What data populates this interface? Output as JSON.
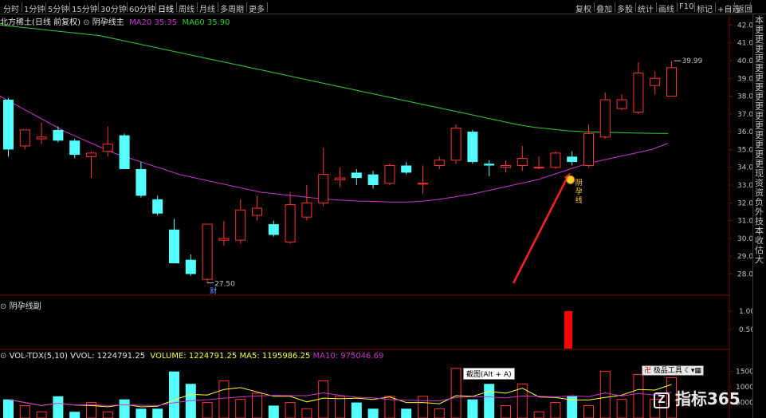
{
  "toolbar": {
    "periods": [
      "分时",
      "1分钟",
      "5分钟",
      "15分钟",
      "30分钟",
      "60分钟",
      "日线",
      "周线",
      "月线",
      "多周期",
      "更多"
    ],
    "active_period": "日线",
    "right_buttons": [
      "复权",
      "叠加",
      "多股",
      "统计",
      "画线",
      "F10",
      "标记",
      "+自选",
      "返回"
    ]
  },
  "main_chart": {
    "title": "北方稀土(日线 前复权)",
    "indicator_name": "阴孕线主",
    "ma20_label": "MA20",
    "ma20_value": "35.35",
    "ma60_label": "MA60",
    "ma60_value": "35.90",
    "price_ticks": [
      "42.00",
      "41.00",
      "40.00",
      "39.00",
      "38.00",
      "37.00",
      "36.00",
      "35.00",
      "34.00",
      "33.00",
      "32.00",
      "31.00",
      "30.00",
      "29.00",
      "28.00"
    ],
    "high_label": "39.99",
    "low_label": "27.50",
    "finance_marker": "财",
    "signal_text": "阴孕线",
    "colors": {
      "up": "#ff3232",
      "down": "#54ffff",
      "ma20": "#cc33cc",
      "ma60": "#33cc33",
      "arrow": "#ff2020"
    }
  },
  "sub_chart": {
    "title": "阴孕线副",
    "ticks": [
      "1.00",
      "0.50"
    ],
    "signal_value": 1.0
  },
  "volume_chart": {
    "title": "VOL-TDX(5,10)",
    "vvol": "VVOL: 1224791.25",
    "volume": "VOLUME: 1224791.25",
    "ma5": "MA5: 1195986.25",
    "ma10": "MA10: 975046.69",
    "ticks": [
      "15000",
      "10000",
      "5000"
    ],
    "tooltip": "截图(Alt + A)",
    "toolbox_label": "极品工具"
  },
  "side_panel": {
    "chars": [
      "本",
      "更",
      "更",
      "更",
      "更",
      "更",
      "更",
      "更",
      "更",
      "更",
      "更",
      "更",
      "更",
      "更",
      "更",
      "更",
      "现",
      "资",
      "资",
      "负",
      "外",
      "技",
      "本",
      "收",
      "估",
      "大"
    ]
  },
  "watermark": "指标365",
  "chart_data": {
    "type": "candlestick",
    "ylim": [
      27,
      42.5
    ],
    "candles": [
      {
        "o": 37.8,
        "h": 37.9,
        "l": 34.6,
        "c": 35.0
      },
      {
        "o": 35.2,
        "h": 36.0,
        "l": 35.0,
        "c": 36.1
      },
      {
        "o": 35.6,
        "h": 36.5,
        "l": 35.3,
        "c": 35.7
      },
      {
        "o": 36.1,
        "h": 36.3,
        "l": 35.4,
        "c": 35.5
      },
      {
        "o": 35.5,
        "h": 35.6,
        "l": 34.5,
        "c": 34.7
      },
      {
        "o": 34.6,
        "h": 34.9,
        "l": 33.4,
        "c": 34.8
      },
      {
        "o": 34.9,
        "h": 36.3,
        "l": 34.6,
        "c": 35.3
      },
      {
        "o": 35.8,
        "h": 35.9,
        "l": 33.9,
        "c": 33.9
      },
      {
        "o": 33.9,
        "h": 34.3,
        "l": 32.3,
        "c": 32.4
      },
      {
        "o": 32.2,
        "h": 32.4,
        "l": 31.3,
        "c": 31.4
      },
      {
        "o": 30.5,
        "h": 31.1,
        "l": 28.6,
        "c": 28.6
      },
      {
        "o": 28.8,
        "h": 29.1,
        "l": 27.9,
        "c": 28.0
      },
      {
        "o": 27.7,
        "h": 30.8,
        "l": 27.5,
        "c": 30.8
      },
      {
        "o": 29.9,
        "h": 31.0,
        "l": 29.6,
        "c": 30.0
      },
      {
        "o": 29.9,
        "h": 32.2,
        "l": 29.7,
        "c": 31.6
      },
      {
        "o": 31.3,
        "h": 32.4,
        "l": 31.0,
        "c": 31.7
      },
      {
        "o": 30.8,
        "h": 31.0,
        "l": 30.1,
        "c": 30.2
      },
      {
        "o": 29.8,
        "h": 32.6,
        "l": 29.7,
        "c": 31.9
      },
      {
        "o": 31.2,
        "h": 33.0,
        "l": 31.0,
        "c": 32.0
      },
      {
        "o": 32.0,
        "h": 35.1,
        "l": 31.8,
        "c": 33.6
      },
      {
        "o": 33.3,
        "h": 34.0,
        "l": 32.9,
        "c": 33.4
      },
      {
        "o": 33.7,
        "h": 33.9,
        "l": 33.0,
        "c": 33.4
      },
      {
        "o": 33.6,
        "h": 33.8,
        "l": 32.8,
        "c": 33.0
      },
      {
        "o": 33.1,
        "h": 34.2,
        "l": 33.0,
        "c": 34.1
      },
      {
        "o": 34.1,
        "h": 34.3,
        "l": 33.6,
        "c": 33.7
      },
      {
        "o": 33.1,
        "h": 34.1,
        "l": 32.5,
        "c": 33.1
      },
      {
        "o": 34.1,
        "h": 34.6,
        "l": 33.9,
        "c": 34.4
      },
      {
        "o": 34.4,
        "h": 36.4,
        "l": 34.2,
        "c": 36.2
      },
      {
        "o": 36.0,
        "h": 36.1,
        "l": 34.2,
        "c": 34.3
      },
      {
        "o": 34.2,
        "h": 34.4,
        "l": 33.5,
        "c": 34.1
      },
      {
        "o": 34.0,
        "h": 34.4,
        "l": 33.7,
        "c": 34.1
      },
      {
        "o": 34.1,
        "h": 35.2,
        "l": 33.8,
        "c": 34.5
      },
      {
        "o": 34.0,
        "h": 34.6,
        "l": 33.9,
        "c": 34.0
      },
      {
        "o": 34.0,
        "h": 34.9,
        "l": 33.9,
        "c": 34.8
      },
      {
        "o": 34.6,
        "h": 34.9,
        "l": 34.1,
        "c": 34.3
      },
      {
        "o": 34.1,
        "h": 36.4,
        "l": 34.0,
        "c": 35.9
      },
      {
        "o": 35.7,
        "h": 38.2,
        "l": 35.6,
        "c": 37.8
      },
      {
        "o": 37.3,
        "h": 38.1,
        "l": 37.2,
        "c": 37.8
      },
      {
        "o": 37.1,
        "h": 39.9,
        "l": 37.0,
        "c": 39.3
      },
      {
        "o": 38.6,
        "h": 39.4,
        "l": 38.1,
        "c": 39.0
      },
      {
        "o": 38.0,
        "h": 39.99,
        "l": 38.0,
        "c": 39.6
      }
    ],
    "ma20": [
      38.0,
      37.5,
      37.0,
      36.5,
      36.0,
      35.6,
      35.2,
      34.8,
      34.5,
      34.2,
      33.9,
      33.6,
      33.4,
      33.2,
      33.0,
      32.8,
      32.6,
      32.5,
      32.4,
      32.3,
      32.2,
      32.15,
      32.1,
      32.08,
      32.05,
      32.05,
      32.1,
      32.2,
      32.35,
      32.5,
      32.7,
      32.9,
      33.1,
      33.3,
      33.6,
      33.9,
      34.2,
      34.4,
      34.6,
      34.8,
      35.0,
      35.35
    ],
    "ma60": [
      42.0,
      41.9,
      41.8,
      41.7,
      41.6,
      41.5,
      41.4,
      41.2,
      41.0,
      40.8,
      40.6,
      40.4,
      40.2,
      40.0,
      39.8,
      39.6,
      39.4,
      39.2,
      39.0,
      38.8,
      38.6,
      38.4,
      38.2,
      38.0,
      37.8,
      37.6,
      37.4,
      37.2,
      37.0,
      36.8,
      36.6,
      36.4,
      36.25,
      36.15,
      36.05,
      36.0,
      35.97,
      35.95,
      35.93,
      35.91,
      35.9
    ],
    "volumes": [
      6,
      4,
      2,
      7,
      2,
      5,
      2,
      6,
      3,
      3,
      15,
      11,
      5,
      12,
      6,
      8,
      4,
      5,
      3,
      12,
      7,
      5,
      3,
      7,
      3,
      7,
      3,
      16,
      6,
      11,
      4,
      11,
      2,
      5,
      7,
      4,
      15,
      6,
      14,
      6,
      13
    ],
    "volume_ylim": [
      0,
      18
    ]
  }
}
